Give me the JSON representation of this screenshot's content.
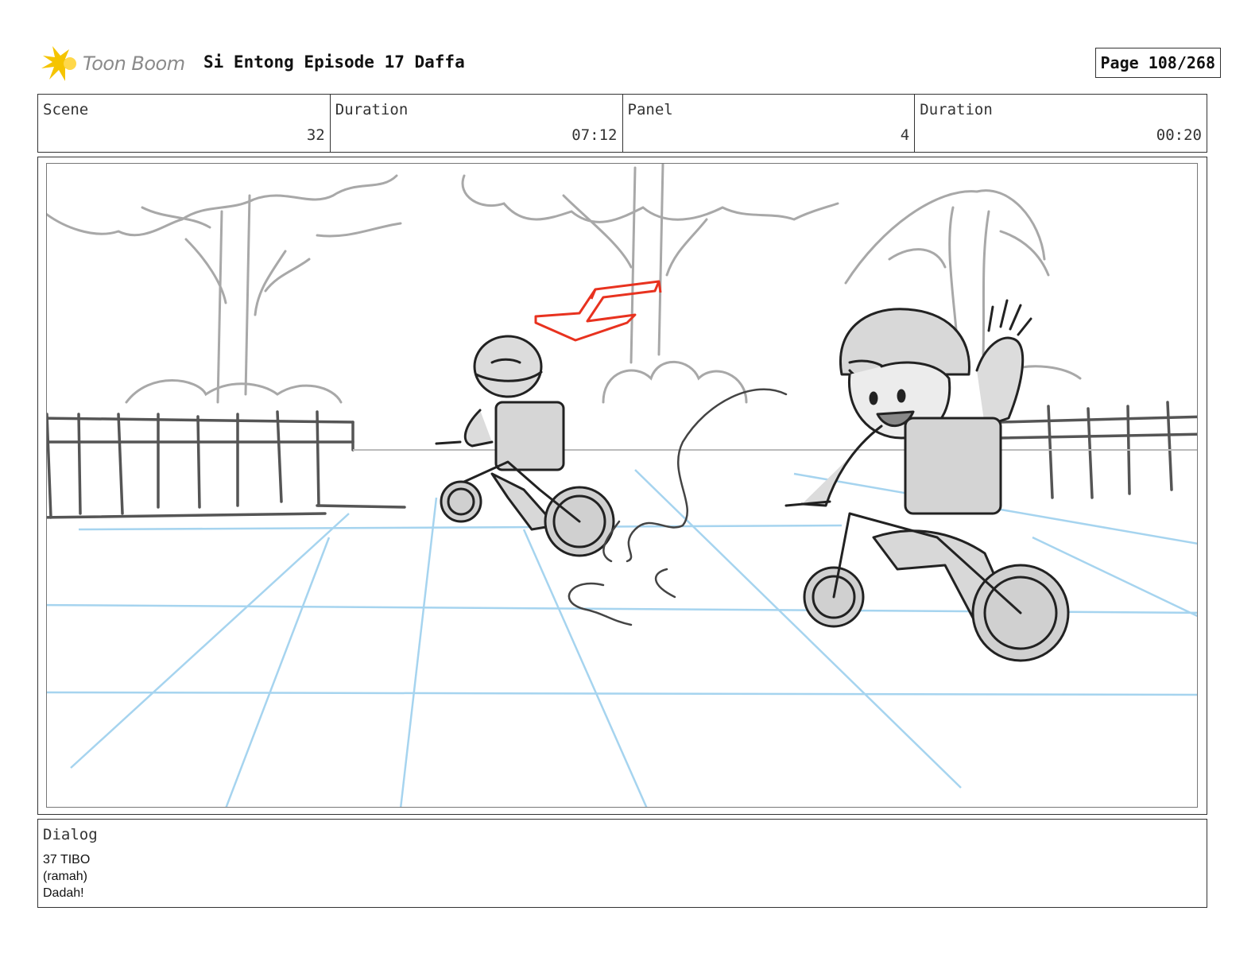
{
  "header": {
    "brand": "Toon Boom",
    "title": "Si Entong Episode 17 Daffa",
    "page": "Page 108/268"
  },
  "info": {
    "scene_label": "Scene",
    "scene_value": "32",
    "duration_label": "Duration",
    "duration_value": "07:12",
    "panel_label": "Panel",
    "panel_value": "4",
    "panel_duration_label": "Duration",
    "panel_duration_value": "00:20"
  },
  "dialog": {
    "label": "Dialog",
    "lines": [
      "37 TIBO",
      "(ramah)",
      "Dadah!"
    ]
  },
  "colors": {
    "sketch": "#333333",
    "background_sketch": "#a8a8a8",
    "perspective_grid": "#a6d4ef",
    "annotation": "#e8321f",
    "logo_star": "#f5c400"
  }
}
